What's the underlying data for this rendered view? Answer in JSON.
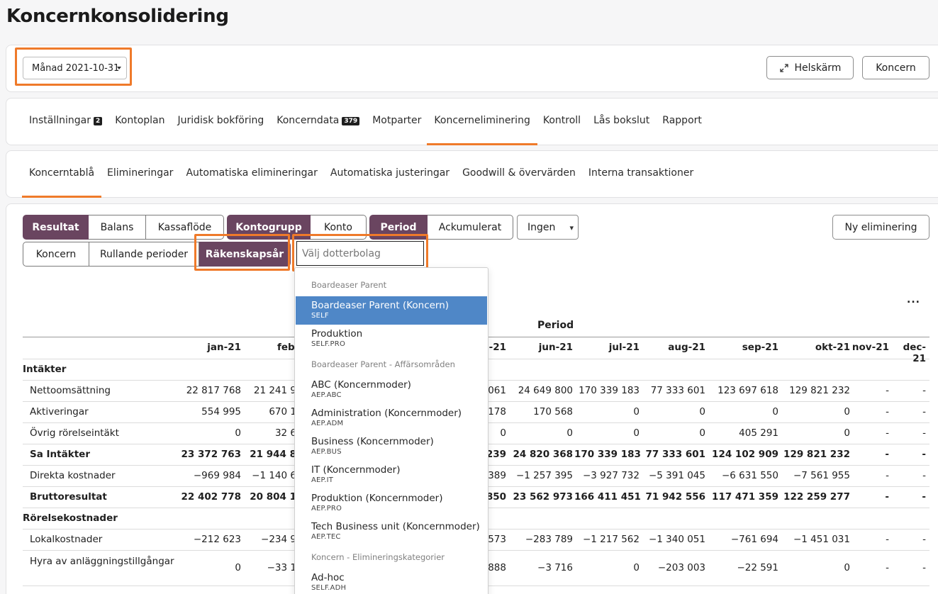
{
  "page_title": "Koncernkonsolidering",
  "period_select": "Månad 2021-10-31",
  "fullscreen_label": "Helskärm",
  "koncern_button": "Koncern",
  "main_tabs": [
    {
      "label": "Inställningar",
      "badge": "2"
    },
    {
      "label": "Kontoplan"
    },
    {
      "label": "Juridisk bokföring"
    },
    {
      "label": "Koncerndata",
      "badge": "379"
    },
    {
      "label": "Motparter"
    },
    {
      "label": "Koncerneliminering",
      "active": true
    },
    {
      "label": "Kontroll"
    },
    {
      "label": "Lås bokslut"
    },
    {
      "label": "Rapport"
    }
  ],
  "sub_tabs": [
    {
      "label": "Koncerntablå",
      "active": true
    },
    {
      "label": "Elimineringar"
    },
    {
      "label": "Automatiska elimineringar"
    },
    {
      "label": "Automatiska justeringar"
    },
    {
      "label": "Goodwill & övervärden"
    },
    {
      "label": "Interna transaktioner"
    }
  ],
  "toggles": {
    "report_type": [
      "Resultat",
      "Balans",
      "Kassaflöde"
    ],
    "grouping": [
      "Kontogrupp",
      "Konto"
    ],
    "mode": [
      "Period",
      "Ackumulerat"
    ],
    "ingen": "Ingen",
    "scope": [
      "Koncern",
      "Rullande perioder",
      "Räkenskapsår"
    ]
  },
  "new_elimination": "Ny eliminering",
  "search_placeholder": "Välj dotterbolag",
  "dropdown": {
    "groups": [
      "Boardeaser Parent",
      "Boardeaser Parent - Affärsområden",
      "Koncern - Elimineringskategorier"
    ],
    "items": [
      {
        "name": "Boardeaser Parent (Koncern)",
        "code": "SELF",
        "selected": true
      },
      {
        "name": "Produktion",
        "code": "SELF.PRO"
      },
      {
        "name": "ABC (Koncernmoder)",
        "code": "AEP.ABC"
      },
      {
        "name": "Administration (Koncernmoder)",
        "code": "AEP.ADM"
      },
      {
        "name": "Business (Koncernmoder)",
        "code": "AEP.BUS"
      },
      {
        "name": "IT (Koncernmoder)",
        "code": "AEP.IT"
      },
      {
        "name": "Produktion (Koncernmoder)",
        "code": "AEP.PRO"
      },
      {
        "name": "Tech Business unit (Koncernmoder)",
        "code": "AEP.TEC"
      },
      {
        "name": "Ad-hoc",
        "code": "SELF.ADH"
      }
    ]
  },
  "table": {
    "period_header": "Period",
    "ellipsis": "...",
    "months": [
      "jan-21",
      "feb-",
      "j-21",
      "jun-21",
      "jul-21",
      "aug-21",
      "sep-21",
      "okt-21",
      "nov-21",
      "dec-21"
    ],
    "section_intakter": "Intäkter",
    "section_rorelse": "Rörelsekostnader",
    "rows": [
      {
        "label": "Nettoomsättning",
        "v": [
          "22 817 768",
          "21 241 9",
          "061",
          "24 649 800",
          "170 339 183",
          "77 333 601",
          "123 697 618",
          "129 821 232",
          "-",
          "-"
        ]
      },
      {
        "label": "Aktiveringar",
        "v": [
          "554 995",
          "670 1",
          "178",
          "170 568",
          "0",
          "0",
          "0",
          "0",
          "-",
          "-"
        ]
      },
      {
        "label": "Övrig rörelseintäkt",
        "v": [
          "0",
          "32 6",
          "0",
          "0",
          "0",
          "0",
          "405 291",
          "0",
          "-",
          "-"
        ]
      },
      {
        "label": "Sa Intäkter",
        "v": [
          "23 372 763",
          "21 944 8",
          "239",
          "24 820 368",
          "170 339 183",
          "77 333 601",
          "124 102 909",
          "129 821 232",
          "-",
          "-"
        ]
      },
      {
        "label": "Direkta kostnader",
        "v": [
          "−969 984",
          "−1 140 6",
          "389",
          "−1 257 395",
          "−3 927 732",
          "−5 391 045",
          "−6 631 550",
          "−7 561 955",
          "-",
          "-"
        ]
      },
      {
        "label": "Bruttoresultat",
        "v": [
          "22 402 778",
          "20 804 1",
          "850",
          "23 562 973",
          "166 411 451",
          "71 942 556",
          "117 471 359",
          "122 259 277",
          "-",
          "-"
        ]
      },
      {
        "label": "Lokalkostnader",
        "v": [
          "−212 623",
          "−234 9",
          "573",
          "−283 789",
          "−1 217 562",
          "−1 340 051",
          "−761 694",
          "−1 451 031",
          "-",
          "-"
        ]
      },
      {
        "label": "Hyra av anläggningstillgångar",
        "v": [
          "0",
          "−33 1",
          "888",
          "−3 716",
          "0",
          "−203 003",
          "−22 591",
          "0",
          "-",
          "-"
        ]
      }
    ]
  }
}
